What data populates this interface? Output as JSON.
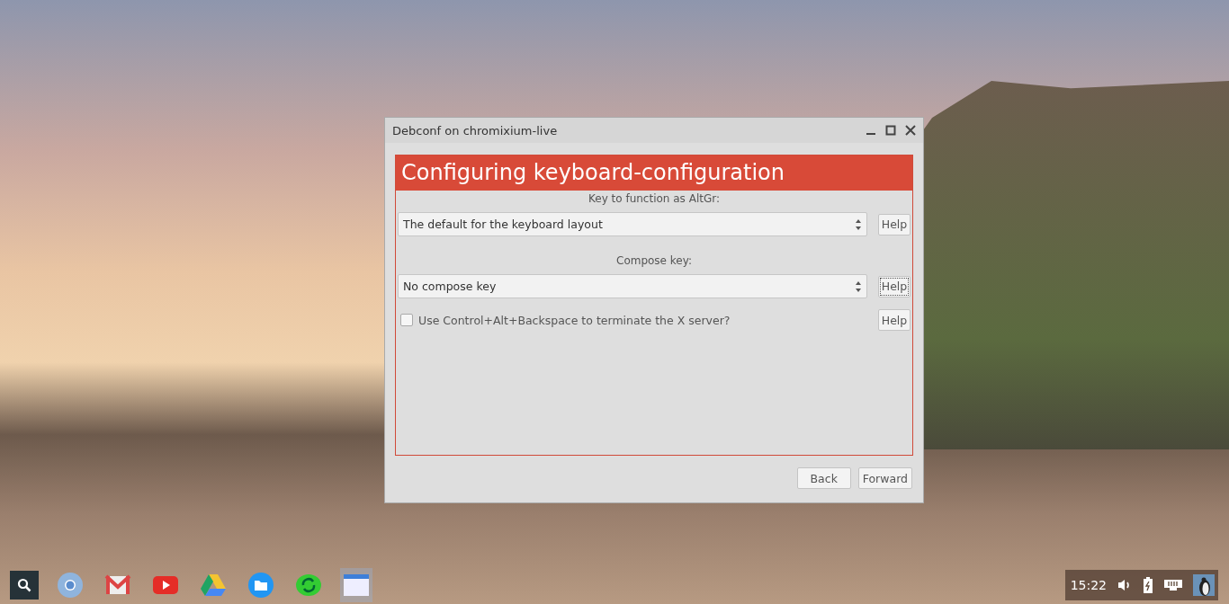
{
  "window": {
    "title": "Debconf on chromixium-live"
  },
  "header": "Configuring keyboard-configuration",
  "questions": [
    {
      "kind": "select",
      "label": "Key to function as AltGr:",
      "value": "The default for the keyboard layout",
      "help": "Help",
      "focused": false
    },
    {
      "kind": "select",
      "label": "Compose key:",
      "value": "No compose key",
      "help": "Help",
      "focused": true
    },
    {
      "kind": "checkbox",
      "text": "Use Control+Alt+Backspace to terminate the X server?",
      "checked": false,
      "help": "Help",
      "focused": false
    }
  ],
  "buttons": [
    "Back",
    "Forward"
  ],
  "shelf": {
    "apps": [
      {
        "kind": "chrome",
        "selected": false
      },
      {
        "kind": "mail",
        "selected": false
      },
      {
        "kind": "video",
        "selected": false
      },
      {
        "kind": "drive",
        "selected": false
      },
      {
        "kind": "files",
        "selected": false
      },
      {
        "kind": "sync",
        "selected": false
      },
      {
        "kind": "window",
        "selected": true
      }
    ],
    "time": "15:22"
  }
}
